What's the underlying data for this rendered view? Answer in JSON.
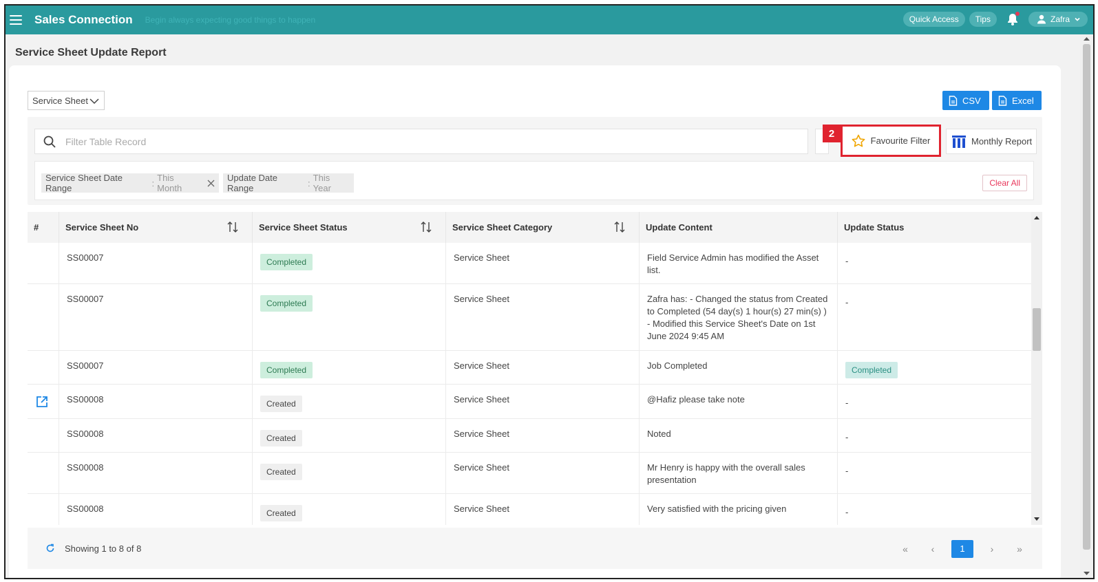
{
  "header": {
    "brand": "Sales Connection",
    "tagline": "Begin always expecting good things to happen",
    "quick_access": "Quick Access",
    "tips": "Tips",
    "user": "Zafra"
  },
  "page": {
    "title": "Service Sheet Update Report"
  },
  "toolbar": {
    "select_value": "Service Sheet",
    "csv_label": "CSV",
    "excel_label": "Excel"
  },
  "filter": {
    "search_placeholder": "Filter Table Record",
    "badge": "2",
    "favourite_label": "Favourite Filter",
    "monthly_label": "Monthly Report",
    "chips": [
      {
        "key": "Service Sheet Date Range",
        "sep": " : ",
        "value": "This Month"
      },
      {
        "key": "Update Date Range",
        "sep": " : ",
        "value": "This Year"
      }
    ],
    "clear_all": "Clear All"
  },
  "table": {
    "columns": [
      "#",
      "Service Sheet No",
      "Service Sheet Status",
      "Service Sheet Category",
      "Update Content",
      "Update Status"
    ],
    "rows": [
      {
        "no": "SS00007",
        "status": "Completed",
        "category": "Service Sheet",
        "content": "Field Service Admin has modified the Asset list.",
        "update_status": "-"
      },
      {
        "no": "SS00007",
        "status": "Completed",
        "category": "Service Sheet",
        "content": "Zafra has: - Changed the status from Created to Completed (54 day(s) 1 hour(s) 27 min(s) ) - Modified this Service Sheet's Date on 1st June 2024 9:45 AM",
        "update_status": "-"
      },
      {
        "no": "SS00007",
        "status": "Completed",
        "category": "Service Sheet",
        "content": "Job Completed",
        "update_status": "Completed"
      },
      {
        "no": "SS00008",
        "status": "Created",
        "category": "Service Sheet",
        "content": "@Hafiz please take note",
        "update_status": "-"
      },
      {
        "no": "SS00008",
        "status": "Created",
        "category": "Service Sheet",
        "content": "Noted",
        "update_status": "-"
      },
      {
        "no": "SS00008",
        "status": "Created",
        "category": "Service Sheet",
        "content": "Mr Henry is happy with the overall sales presentation",
        "update_status": "-"
      },
      {
        "no": "SS00008",
        "status": "Created",
        "category": "Service Sheet",
        "content": "Very satisfied with the pricing given",
        "update_status": "-"
      }
    ]
  },
  "footer": {
    "showing": "Showing 1 to 8 of 8",
    "first": "«",
    "prev": "‹",
    "page": "1",
    "next": "›",
    "last": "»"
  },
  "colors": {
    "topbar": "#2a9a9e",
    "primary": "#1e88e5",
    "highlight": "#e0232f"
  }
}
